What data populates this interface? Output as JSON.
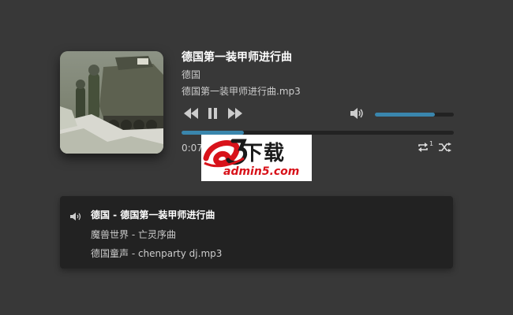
{
  "track": {
    "title": "德国第一装甲师进行曲",
    "artist": "德国",
    "file": "德国第一装甲师进行曲.mp3"
  },
  "controls": {
    "prev_icon": "skip-back-icon",
    "pause_icon": "pause-icon",
    "next_icon": "skip-forward-icon",
    "volume_icon": "volume-icon",
    "repeat_icon": "repeat-icon",
    "shuffle_icon": "shuffle-icon",
    "repeat_count": "1"
  },
  "volume_fraction": 0.76,
  "progress_fraction": 0.23,
  "time": {
    "current": "0:07"
  },
  "colors": {
    "background": "#383838",
    "accent": "#3a86ad",
    "track": "#222222",
    "playlist_bg": "#222222",
    "logo_red": "#d8121a"
  },
  "watermark": {
    "brand": "下载",
    "domain": "admin5.com"
  },
  "playlist": {
    "items": [
      {
        "label": "德国 - 德国第一装甲师进行曲",
        "active": true
      },
      {
        "label": "魔兽世界 - 亡灵序曲",
        "active": false
      },
      {
        "label": "德国童声 - chenparty dj.mp3",
        "active": false
      }
    ]
  }
}
